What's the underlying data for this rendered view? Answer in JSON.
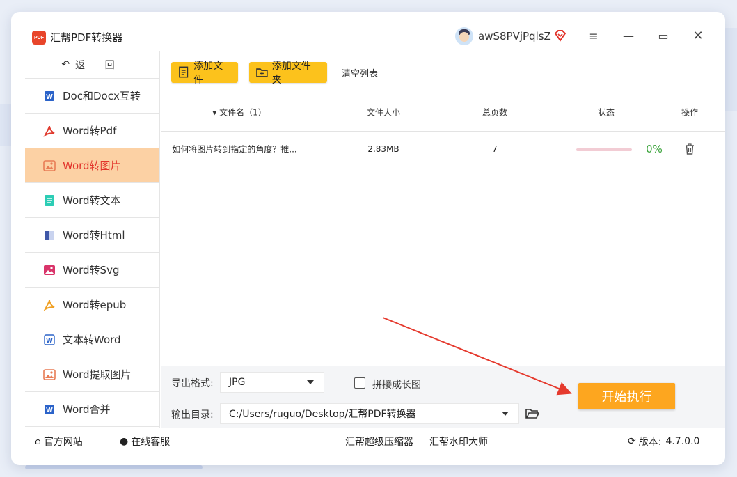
{
  "app": {
    "title": "汇帮PDF转换器",
    "logo_text": "PDF"
  },
  "user": {
    "name": "awS8PVjPqlsZ"
  },
  "window_controls": {
    "menu": "≡",
    "minimize": "—",
    "maximize": "▭",
    "close": "✕"
  },
  "sidebar": {
    "back_label": "返 回",
    "items": [
      {
        "label": "Doc和Docx互转",
        "icon": "word-icon"
      },
      {
        "label": "Word转Pdf",
        "icon": "pdf-icon"
      },
      {
        "label": "Word转图片",
        "icon": "image-icon",
        "active": true
      },
      {
        "label": "Word转文本",
        "icon": "text-icon"
      },
      {
        "label": "Word转Html",
        "icon": "html-icon"
      },
      {
        "label": "Word转Svg",
        "icon": "svg-icon"
      },
      {
        "label": "Word转epub",
        "icon": "epub-icon"
      },
      {
        "label": "文本转Word",
        "icon": "word-outline-icon"
      },
      {
        "label": "Word提取图片",
        "icon": "extract-image-icon"
      },
      {
        "label": "Word合并",
        "icon": "word-icon"
      }
    ]
  },
  "toolbar": {
    "add_file": "添加文件",
    "add_folder": "添加文件夹",
    "clear_list": "清空列表"
  },
  "table": {
    "headers": {
      "name": "▾ 文件名（1）",
      "size": "文件大小",
      "pages": "总页数",
      "status": "状态",
      "action": "操作"
    },
    "rows": [
      {
        "name": "如何将图片转到指定的角度？推...",
        "size": "2.83MB",
        "pages": "7",
        "progress": 0,
        "progress_text": "0%"
      }
    ]
  },
  "bottom": {
    "format_label": "导出格式:",
    "format_value": "JPG",
    "stitch_label": "拼接成长图",
    "stitch_checked": false,
    "dir_label": "输出目录:",
    "dir_value": "C:/Users/ruguo/Desktop/汇帮PDF转换器",
    "start_label": "开始执行"
  },
  "footer": {
    "website": "官方网站",
    "support": "在线客服",
    "compressor": "汇帮超级压缩器",
    "watermark": "汇帮水印大师",
    "version_label": "版本:",
    "version": "4.7.0.0"
  },
  "colors": {
    "accent": "#fcc21c",
    "active_bg": "#fcd1a4",
    "active_text": "#e2342b",
    "start_btn": "#fda61f",
    "progress": "#3aa33a"
  }
}
